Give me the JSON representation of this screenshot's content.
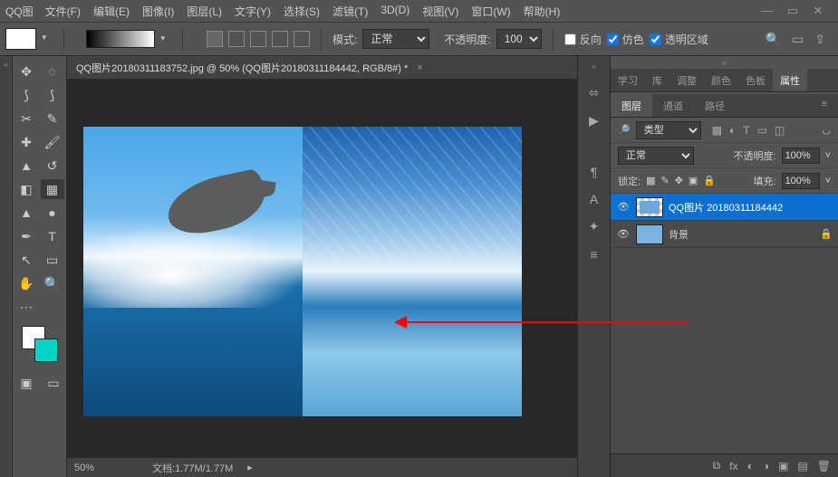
{
  "app_title": "QQ图",
  "menu": {
    "file": "文件(F)",
    "edit": "编辑(E)",
    "image": "图像(I)",
    "layer": "图层(L)",
    "type": "文字(Y)",
    "select": "选择(S)",
    "filter": "滤镜(T)",
    "three_d": "3D(D)",
    "view": "视图(V)",
    "window": "窗口(W)",
    "help": "帮助(H)"
  },
  "options": {
    "mode_label": "模式:",
    "mode_value": "正常",
    "opacity_label": "不透明度:",
    "opacity_value": "100%",
    "reverse": "反向",
    "dither": "仿色",
    "transparency": "透明区域"
  },
  "document": {
    "tab_title": "QQ图片20180311183752.jpg @ 50% (QQ图片20180311184442, RGB/8#) *",
    "zoom": "50%",
    "filesize_label": "文档:",
    "filesize": "1.77M/1.77M"
  },
  "panels": {
    "top_tabs": {
      "learn": "学习",
      "library": "库",
      "adjust": "调整",
      "color": "颜色",
      "swatches": "色板",
      "properties": "属性"
    },
    "layer_tabs": {
      "layers": "图层",
      "channels": "通道",
      "paths": "路径"
    },
    "filter_label": "类型",
    "blend_mode": "正常",
    "opacity_label": "不透明度:",
    "opacity_value": "100%",
    "lock_label": "锁定:",
    "fill_label": "填充:",
    "fill_value": "100%",
    "layers": [
      {
        "name": "QQ图片 20180311184442",
        "locked": false,
        "selected": true
      },
      {
        "name": "背景",
        "locked": true,
        "selected": false
      }
    ]
  }
}
